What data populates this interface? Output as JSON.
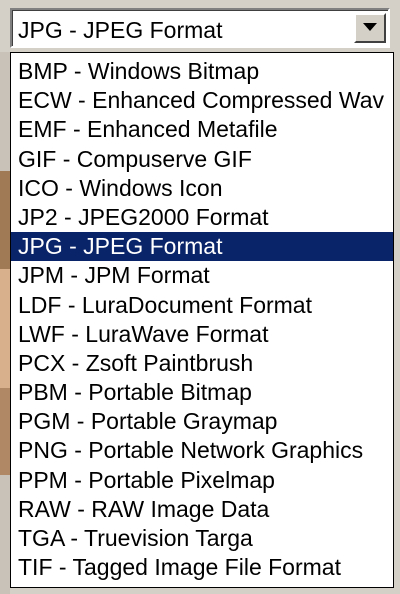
{
  "combobox": {
    "value": "JPG - JPEG Format",
    "button_icon": "chevron-down-icon"
  },
  "dropdown": {
    "selected_index": 6,
    "selected_background": "#0a246a",
    "options": [
      "BMP - Windows Bitmap",
      "ECW - Enhanced Compressed Wav",
      "EMF - Enhanced Metafile",
      "GIF - Compuserve GIF",
      "ICO - Windows Icon",
      "JP2 - JPEG2000 Format",
      "JPG - JPEG Format",
      "JPM - JPM Format",
      "LDF - LuraDocument Format",
      "LWF - LuraWave Format",
      "PCX - Zsoft Paintbrush",
      "PBM - Portable Bitmap",
      "PGM - Portable Graymap",
      "PNG - Portable Network Graphics",
      "PPM - Portable Pixelmap",
      "RAW - RAW Image Data",
      "TGA - Truevision Targa",
      "TIF - Tagged Image File Format"
    ]
  }
}
